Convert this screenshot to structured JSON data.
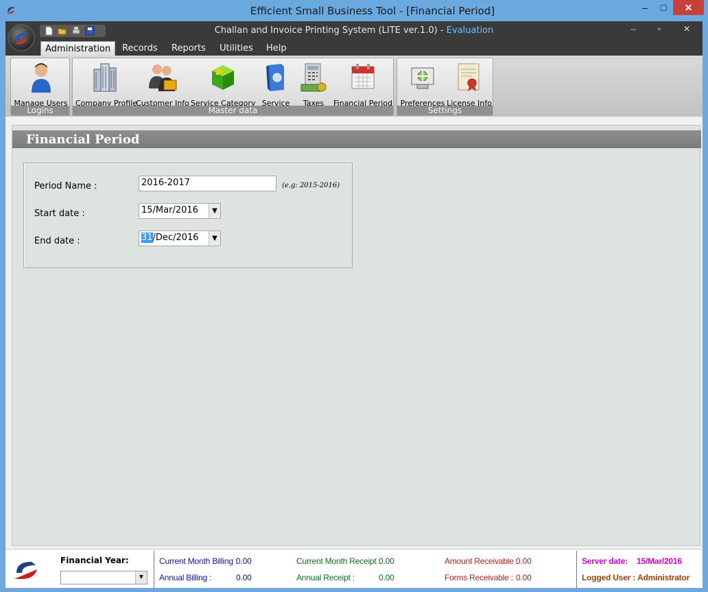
{
  "outer_window": {
    "title": "Efficient Small Business Tool - [Financial Period]",
    "min_glyph": "–",
    "max_glyph": "□",
    "close_glyph": "✕"
  },
  "inner_window": {
    "title": "Challan and Invoice Printing System (LITE ver.1.0) - ",
    "title_suffix": "Evaluation",
    "min_glyph": "–",
    "restore_glyph": "▫",
    "close_glyph": "✕"
  },
  "menu": {
    "tabs": [
      {
        "label": "Administration",
        "active": true
      },
      {
        "label": "Records"
      },
      {
        "label": "Reports"
      },
      {
        "label": "Utilities"
      },
      {
        "label": "Help"
      }
    ]
  },
  "ribbon": {
    "groups": [
      {
        "label": "Logins",
        "buttons": [
          {
            "label": "Manage Users",
            "icon": "user-icon"
          }
        ]
      },
      {
        "label": "Master data",
        "buttons": [
          {
            "label": "Company Profile",
            "icon": "buildings-icon"
          },
          {
            "label": "Customer Info",
            "icon": "customers-icon"
          },
          {
            "label": "Service Category",
            "icon": "cube-icon"
          },
          {
            "label": "Service",
            "icon": "service-box-icon"
          },
          {
            "label": "Taxes",
            "icon": "calculator-icon"
          },
          {
            "label": "Financial Period",
            "icon": "calendar-icon"
          }
        ]
      },
      {
        "label": "Settings",
        "buttons": [
          {
            "label": "Preferences",
            "icon": "preferences-icon"
          },
          {
            "label": "License Info",
            "icon": "certificate-icon"
          }
        ]
      }
    ]
  },
  "panel": {
    "title": "Financial Period"
  },
  "form": {
    "period_name_label": "Period Name :",
    "period_name_value": "2016-2017",
    "period_name_hint": "(e.g: 2015-2016)",
    "start_date_label": "Start date :",
    "start_date_value": "15/Mar/2016",
    "end_date_label": "End date :",
    "end_date_selected": "31",
    "end_date_rest": "/Dec/2016"
  },
  "status": {
    "financial_year_label": "Financial Year:",
    "financial_year_value": "",
    "current_month_billing_label": "Current Month Billing :",
    "current_month_billing_value": "0.00",
    "annual_billing_label": "Annual Billing :",
    "annual_billing_value": "0.00",
    "current_month_receipt_label": "Current Month Receipt :",
    "current_month_receipt_value": "0.00",
    "annual_receipt_label": "Annual Receipt :",
    "annual_receipt_value": "0.00",
    "amount_receivable_label": "Amount Receivable :",
    "amount_receivable_value": "0.00",
    "forms_receivable_label": "Forms Receivable :",
    "forms_receivable_value": "0.00",
    "server_date_label": "Server date:",
    "server_date_value": "15/Mar/2016",
    "logged_user_label": "Logged User :",
    "logged_user_value": "Administrator"
  },
  "colors": {
    "outer_titlebar": "#6aa9e0",
    "inner_frame": "#3a3a3a",
    "panel_header": "#7b7b7b",
    "content_bg": "#dce3e1",
    "evaluation_accent": "#6fc3ff",
    "close_button": "#c7413a"
  }
}
